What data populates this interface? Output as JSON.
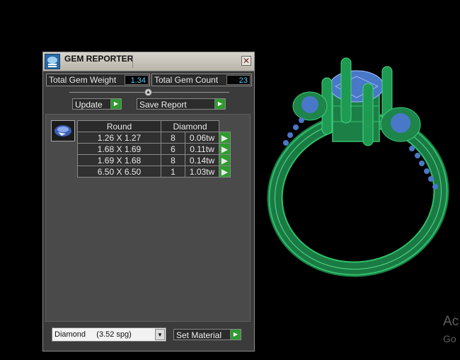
{
  "window": {
    "title": "GEM REPORTER",
    "close_glyph": "✕"
  },
  "stats": {
    "total_weight_label": "Total Gem Weight",
    "total_weight_value": "1.34",
    "total_count_label": "Total Gem Count",
    "total_count_value": "23"
  },
  "buttons": {
    "update": "Update",
    "save_report": "Save Report",
    "set_material": "Set Material"
  },
  "table": {
    "shape": "Round",
    "material": "Diamond",
    "rows": [
      {
        "size": "1.26 X 1.27",
        "count": "8",
        "carat": "0.06tw"
      },
      {
        "size": "1.68 X 1.69",
        "count": "6",
        "carat": "0.11tw"
      },
      {
        "size": "1.69 X 1.68",
        "count": "8",
        "carat": "0.14tw"
      },
      {
        "size": "6.50 X 6.50",
        "count": "1",
        "carat": "1.03tw"
      }
    ]
  },
  "material_select": {
    "value": "Diamond     (3.52 spg)"
  },
  "watermark": {
    "line1": "Ac",
    "line2": "Go"
  },
  "colors": {
    "metal": "#1e8a4c",
    "gem": "#4a78c8",
    "play_button": "#2f9a2f",
    "value_text": "#4fc8ff"
  },
  "icons": [
    "gem-reporter-app-icon",
    "close-icon",
    "collapse-arrow-icon",
    "play-arrow-icon",
    "dropdown-arrow-icon",
    "round-gem-icon"
  ]
}
